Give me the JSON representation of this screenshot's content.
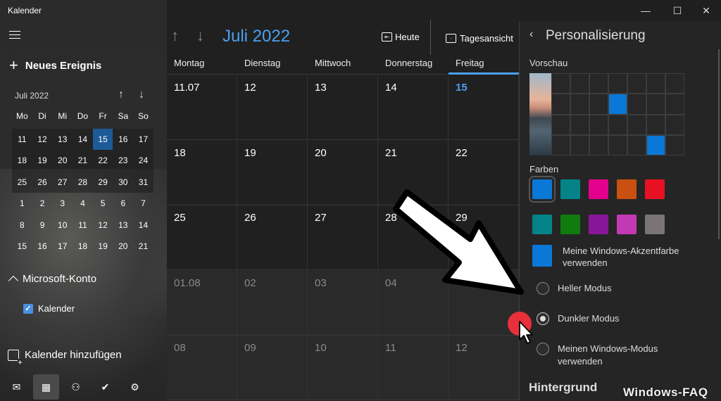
{
  "app": {
    "title": "Kalender"
  },
  "sidebar": {
    "new_event": "Neues Ereignis",
    "mini_month": "Juli 2022",
    "weekdays": [
      "Mo",
      "Di",
      "Mi",
      "Do",
      "Fr",
      "Sa",
      "So"
    ],
    "weeks": [
      [
        "11",
        "12",
        "13",
        "14",
        "15",
        "16",
        "17"
      ],
      [
        "18",
        "19",
        "20",
        "21",
        "22",
        "23",
        "24"
      ],
      [
        "25",
        "26",
        "27",
        "28",
        "29",
        "30",
        "31"
      ],
      [
        "1",
        "2",
        "3",
        "4",
        "5",
        "6",
        "7"
      ],
      [
        "8",
        "9",
        "10",
        "11",
        "12",
        "13",
        "14"
      ],
      [
        "15",
        "16",
        "17",
        "18",
        "19",
        "20",
        "21"
      ]
    ],
    "selected_day": "15",
    "account": "Microsoft-Konto",
    "calendar_item": "Kalender",
    "add_calendar": "Kalender hinzufügen",
    "bottom_icons": [
      "mail-icon",
      "calendar-icon",
      "people-icon",
      "todo-icon",
      "settings-icon"
    ]
  },
  "main": {
    "month_title": "Juli 2022",
    "today": "Heute",
    "day_view": "Tagesansicht",
    "columns": [
      "Montag",
      "Dienstag",
      "Mittwoch",
      "Donnerstag",
      "Freitag"
    ],
    "weeks": [
      [
        "11.07",
        "12",
        "13",
        "14",
        "15"
      ],
      [
        "18",
        "19",
        "20",
        "21",
        "22"
      ],
      [
        "25",
        "26",
        "27",
        "28",
        "29"
      ],
      [
        "01.08",
        "02",
        "03",
        "04",
        ""
      ],
      [
        "08",
        "09",
        "10",
        "11",
        "12"
      ]
    ]
  },
  "panel": {
    "title": "Personalisierung",
    "preview_label": "Vorschau",
    "colors_label": "Farben",
    "colors_row1": [
      "#0a78d7",
      "#038387",
      "#e3008c",
      "#ca5010",
      "#e81123"
    ],
    "colors_row2": [
      "#038387",
      "#107c10",
      "#881798",
      "#c239b3",
      "#7a7574"
    ],
    "accent_text": "Meine Windows-Akzentfarbe verwenden",
    "mode_light": "Heller Modus",
    "mode_dark": "Dunkler Modus",
    "mode_windows": "Meinen Windows-Modus verwenden",
    "background": "Hintergrund"
  },
  "watermark": "Windows-FAQ"
}
